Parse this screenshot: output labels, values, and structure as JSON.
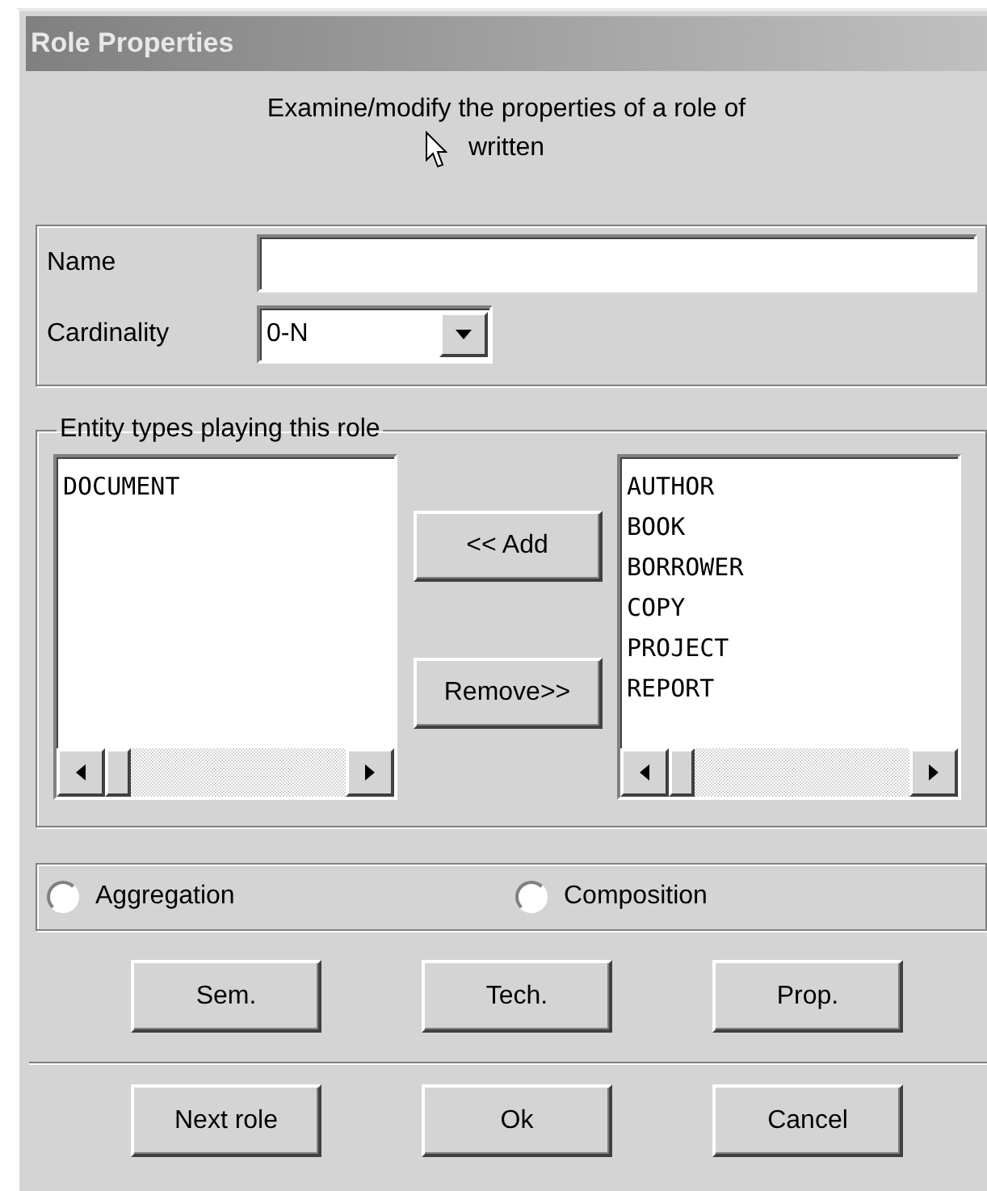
{
  "window": {
    "title": "Role Properties"
  },
  "description": [
    "Examine/modify the properties of a role of",
    "written"
  ],
  "fields": {
    "name_label": "Name",
    "cardinality_label": "Cardinality",
    "cardinality_value": "0-N"
  },
  "entity_group": {
    "title": "Entity types playing this role",
    "playing": [
      "DOCUMENT"
    ],
    "available": [
      "AUTHOR",
      "BOOK",
      "BORROWER",
      "COPY",
      "PROJECT",
      "REPORT"
    ],
    "add_button": "<< Add",
    "remove_button": "Remove>>"
  },
  "radios": [
    {
      "label": "Aggregation",
      "selected": false
    },
    {
      "label": "Composition",
      "selected": false
    }
  ],
  "buttons": [
    "Sem.",
    "Tech.",
    "Prop."
  ],
  "footer_buttons": [
    "Next role",
    "Ok",
    "Cancel"
  ]
}
